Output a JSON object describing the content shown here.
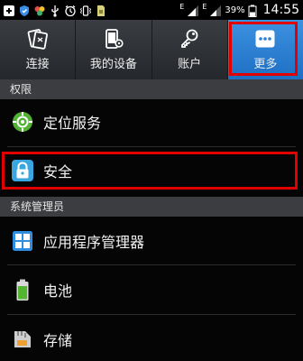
{
  "status_bar": {
    "battery_percent": "39%",
    "time": "14:55",
    "network_letter_1": "E",
    "network_letter_2": "E",
    "icons": [
      "plus-icon",
      "shield-icon",
      "color-balls-icon",
      "usb-icon",
      "alarm-icon",
      "vibrate-icon",
      "sim-card-icon",
      "signal-icon",
      "signal-icon",
      "battery-icon"
    ]
  },
  "tabs": [
    {
      "label": "连接",
      "icon": "connections-icon"
    },
    {
      "label": "我的设备",
      "icon": "my-device-icon"
    },
    {
      "label": "账户",
      "icon": "accounts-key-icon"
    },
    {
      "label": "更多",
      "icon": "more-dots-icon"
    }
  ],
  "selected_tab": "更多",
  "sections": [
    {
      "header": "权限",
      "items": [
        {
          "label": "定位服务",
          "icon": "location-icon"
        },
        {
          "label": "安全",
          "icon": "lock-icon"
        }
      ]
    },
    {
      "header": "系统管理员",
      "items": [
        {
          "label": "应用程序管理器",
          "icon": "app-grid-icon"
        },
        {
          "label": "电池",
          "icon": "battery-icon"
        },
        {
          "label": "存储",
          "icon": "storage-icon"
        }
      ]
    }
  ],
  "colors": {
    "highlight_red": "#e00000",
    "selected_tab_blue": "#2a7fd4",
    "section_header_bg": "#3b3d40"
  }
}
